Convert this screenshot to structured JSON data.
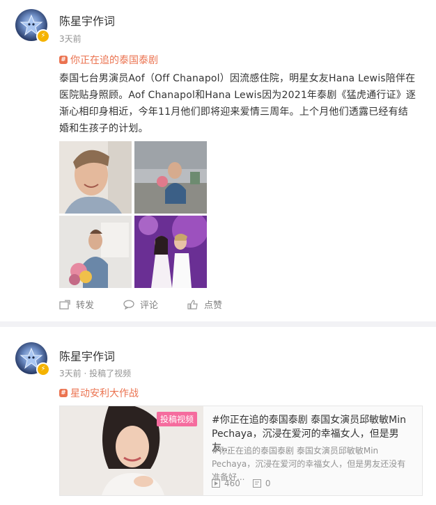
{
  "post1": {
    "username": "陈星宇作词",
    "time": "3天前",
    "topic": "你正在追的泰国泰剧",
    "text": "泰国七台男演员Aof（Off Chanapol）因流感住院，明星女友Hana Lewis陪伴在医院贴身照顾。Aof Chanapol和Hana Lewis因为2021年泰剧《猛虎通行证》逐渐心相印身相近，今年11月他们即将迎来爱情三周年。上个月他们透露已经有结婚和生孩子的计划。",
    "actions": {
      "repost": "转发",
      "comment": "评论",
      "like": "点赞"
    }
  },
  "post2": {
    "username": "陈星宇作词",
    "time": "3天前 · 投稿了视频",
    "topic": "星动安利大作战",
    "video": {
      "label": "投稿视频",
      "title": "#你正在追的泰国泰剧 泰国女演员邱敏敏Min Pechaya，沉浸在爱河的幸福女人，但是男友...",
      "desc": "#你正在追的泰国泰剧 泰国女演员邱敏敏Min Pechaya，沉浸在爱河的幸福女人，但是男友还没有准备好...",
      "plays": "460",
      "comments": "0"
    }
  },
  "colors": {
    "accent": "#eb7350",
    "badge": "#f5b300",
    "video_label": "#f56c9e"
  }
}
